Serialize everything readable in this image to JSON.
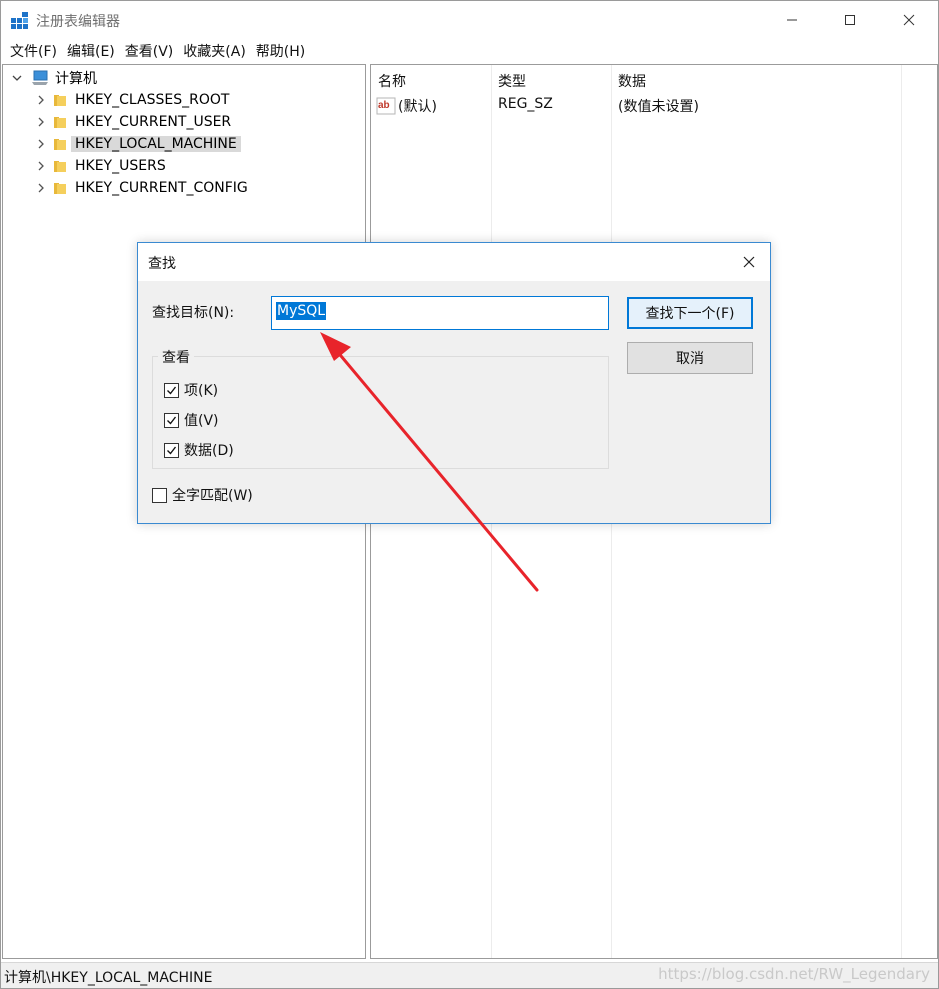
{
  "window": {
    "title": "注册表编辑器"
  },
  "menu": [
    "文件(F)",
    "编辑(E)",
    "查看(V)",
    "收藏夹(A)",
    "帮助(H)"
  ],
  "tree": {
    "root": "计算机",
    "items": [
      {
        "label": "HKEY_CLASSES_ROOT",
        "selected": false
      },
      {
        "label": "HKEY_CURRENT_USER",
        "selected": false
      },
      {
        "label": "HKEY_LOCAL_MACHINE",
        "selected": true
      },
      {
        "label": "HKEY_USERS",
        "selected": false
      },
      {
        "label": "HKEY_CURRENT_CONFIG",
        "selected": false
      }
    ]
  },
  "list": {
    "columns": [
      "名称",
      "类型",
      "数据"
    ],
    "rows": [
      {
        "name": "(默认)",
        "type": "REG_SZ",
        "data": "(数值未设置)"
      }
    ]
  },
  "dialog": {
    "title": "查找",
    "find_label": "查找目标(N):",
    "find_value": "MySQL",
    "find_next_label": "查找下一个(F)",
    "cancel_label": "取消",
    "group_label": "查看",
    "options": [
      {
        "label": "项(K)",
        "checked": true
      },
      {
        "label": "值(V)",
        "checked": true
      },
      {
        "label": "数据(D)",
        "checked": true
      }
    ],
    "whole_word": {
      "label": "全字匹配(W)",
      "checked": false
    }
  },
  "status": {
    "path": "计算机\\HKEY_LOCAL_MACHINE"
  },
  "watermark": "https://blog.csdn.net/RW_Legendary",
  "colors": {
    "accent": "#0078d7",
    "annotation_arrow": "#e8242b",
    "folder": "#e8b83a"
  }
}
